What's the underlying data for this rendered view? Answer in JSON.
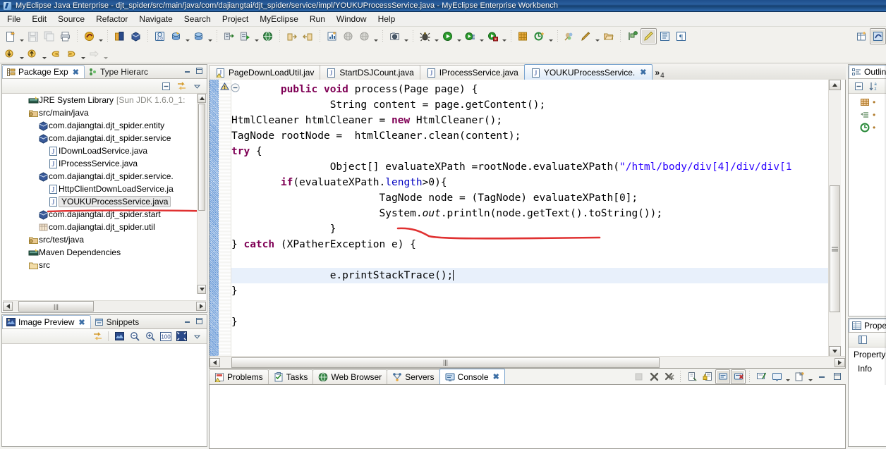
{
  "window": {
    "title": "MyEclipse Java Enterprise - djt_spider/src/main/java/com/dajiangtai/djt_spider/service/impl/YOUKUProcessService.java - MyEclipse Enterprise Workbench",
    "icon": "myeclipse-icon"
  },
  "menubar": {
    "items": [
      {
        "label": "File"
      },
      {
        "label": "Edit"
      },
      {
        "label": "Source"
      },
      {
        "label": "Refactor"
      },
      {
        "label": "Navigate"
      },
      {
        "label": "Search"
      },
      {
        "label": "Project"
      },
      {
        "label": "MyEclipse"
      },
      {
        "label": "Run"
      },
      {
        "label": "Window"
      },
      {
        "label": "Help"
      }
    ]
  },
  "toolbar": {
    "row1": [
      {
        "name": "new-wizard",
        "icon": "new-file-icon",
        "caret": true
      },
      {
        "name": "save",
        "icon": "save-icon",
        "caret": false,
        "disabled": true
      },
      {
        "name": "save-all",
        "icon": "save-all-icon",
        "caret": false,
        "disabled": true
      },
      {
        "name": "print",
        "icon": "print-icon",
        "caret": false
      },
      {
        "sep": true
      },
      {
        "name": "myeclipse-perspective",
        "icon": "myeclipse-icon",
        "caret": true
      },
      {
        "sep": true
      },
      {
        "name": "open-deploy",
        "icon": "deploy-icon",
        "caret": false
      },
      {
        "name": "open-package",
        "icon": "package-icon",
        "caret": false
      },
      {
        "sep": true
      },
      {
        "name": "web-2",
        "icon": "web20-icon",
        "caret": false
      },
      {
        "name": "db-browser",
        "icon": "db-icon",
        "caret": true
      },
      {
        "name": "db-explorer",
        "icon": "db2-icon",
        "caret": true
      },
      {
        "sep": true
      },
      {
        "name": "server-deploy",
        "icon": "server-deploy-icon",
        "caret": false
      },
      {
        "name": "run-server",
        "icon": "run-server-icon",
        "caret": true
      },
      {
        "name": "open-browser",
        "icon": "globe-icon",
        "caret": false
      },
      {
        "sep": true
      },
      {
        "name": "export",
        "icon": "export-icon",
        "caret": false
      },
      {
        "name": "import",
        "icon": "import-icon",
        "caret": false
      },
      {
        "sep": true
      },
      {
        "name": "report",
        "icon": "report-icon",
        "caret": false
      },
      {
        "name": "globe-dim",
        "icon": "globe-dim-icon",
        "caret": false
      },
      {
        "name": "globe-dim-2",
        "icon": "globe-dim2-icon",
        "caret": true
      },
      {
        "sep": true
      },
      {
        "name": "snapshot",
        "icon": "camera-icon",
        "caret": true
      },
      {
        "sep": true
      },
      {
        "name": "debug",
        "icon": "debug-bug-icon",
        "caret": true
      },
      {
        "name": "run",
        "icon": "run-green-icon",
        "caret": true
      },
      {
        "name": "run-history",
        "icon": "run-history-icon",
        "caret": true
      },
      {
        "name": "run-error",
        "icon": "run-error-icon",
        "caret": true
      },
      {
        "sep": true
      },
      {
        "name": "new-java-project",
        "icon": "new-java-project-icon",
        "caret": false
      },
      {
        "name": "new-class",
        "icon": "new-class-icon",
        "caret": true
      },
      {
        "sep": true
      },
      {
        "name": "search-ref",
        "icon": "search-ref-icon",
        "caret": false
      },
      {
        "name": "edit-pencil",
        "icon": "pencil-icon",
        "caret": true
      },
      {
        "name": "open-type",
        "icon": "open-type-icon",
        "caret": false
      },
      {
        "sep": true
      },
      {
        "name": "next-annotation",
        "icon": "next-annotation-icon",
        "caret": false
      },
      {
        "name": "toggle-mark-occurrences",
        "icon": "highlighter-icon",
        "caret": false,
        "pressed": true
      },
      {
        "name": "show-whitespace",
        "icon": "whitespace-icon",
        "caret": false
      },
      {
        "name": "pilcrow",
        "icon": "pilcrow-icon",
        "caret": false
      }
    ],
    "row1_far": [
      {
        "name": "new-table",
        "icon": "new-table-icon"
      },
      {
        "name": "myeclipse-perspective-btn",
        "icon": "perspective-icon",
        "pressed": true
      }
    ],
    "row2": [
      {
        "name": "step-down",
        "icon": "arrow-down-icon",
        "caret": true
      },
      {
        "name": "step-up",
        "icon": "arrow-up-icon",
        "caret": true
      },
      {
        "name": "back",
        "icon": "back-arrow-icon",
        "caret": false
      },
      {
        "name": "forward",
        "icon": "forward-arrow-icon",
        "caret": true
      },
      {
        "name": "next-edit",
        "icon": "next-edit-icon",
        "caret": true,
        "disabled": true
      }
    ]
  },
  "package_explorer": {
    "tabs": [
      {
        "label": "Package Exp",
        "icon": "package-explorer-icon",
        "active": true,
        "closable": true
      },
      {
        "label": "Type Hierarc",
        "icon": "type-hierarchy-icon",
        "active": false,
        "closable": false
      }
    ],
    "toolbar": [
      {
        "name": "collapse-all",
        "icon": "collapse-all-icon"
      },
      {
        "name": "link-with-editor",
        "icon": "link-editor-icon"
      },
      {
        "name": "view-menu",
        "icon": "view-menu-icon"
      }
    ],
    "tree": [
      {
        "label": "JRE System Library",
        "suffix": "[Sun JDK 1.6.0_1:",
        "icon": "library-icon",
        "indent": 2
      },
      {
        "label": "src/main/java",
        "suffix": "",
        "icon": "source-folder-icon",
        "indent": 2
      },
      {
        "label": "com.dajiangtai.djt_spider.entity",
        "suffix": "",
        "icon": "package-icon",
        "indent": 3
      },
      {
        "label": "com.dajiangtai.djt_spider.service",
        "suffix": "",
        "icon": "package-icon",
        "indent": 3
      },
      {
        "label": "IDownLoadService.java",
        "suffix": "",
        "icon": "java-file-icon",
        "indent": 4
      },
      {
        "label": "IProcessService.java",
        "suffix": "",
        "icon": "java-file-icon",
        "indent": 4
      },
      {
        "label": "com.dajiangtai.djt_spider.service.",
        "suffix": "",
        "icon": "package-icon",
        "indent": 3
      },
      {
        "label": "HttpClientDownLoadService.ja",
        "suffix": "",
        "icon": "java-file-icon",
        "indent": 4
      },
      {
        "label": "YOUKUProcessService.java",
        "suffix": "",
        "icon": "java-file-icon",
        "indent": 4,
        "selected": true
      },
      {
        "label": "com.dajiangtai.djt_spider.start",
        "suffix": "",
        "icon": "package-icon",
        "indent": 3
      },
      {
        "label": "com.dajiangtai.djt_spider.util",
        "suffix": "",
        "icon": "package-empty-icon",
        "indent": 3
      },
      {
        "label": "src/test/java",
        "suffix": "",
        "icon": "source-folder-icon",
        "indent": 2
      },
      {
        "label": "Maven Dependencies",
        "suffix": "",
        "icon": "library-icon",
        "indent": 2
      },
      {
        "label": "src",
        "suffix": "",
        "icon": "folder-icon",
        "indent": 2
      }
    ]
  },
  "image_preview": {
    "tabs": [
      {
        "label": "Image Preview",
        "icon": "image-preview-icon",
        "active": true,
        "closable": true
      },
      {
        "label": "Snippets",
        "icon": "snippets-icon",
        "active": false,
        "closable": false
      }
    ],
    "toolbar": [
      {
        "name": "link-with-editor",
        "icon": "link-editor-icon"
      },
      {
        "name": "preview-image",
        "icon": "image-icon"
      },
      {
        "name": "zoom-out",
        "icon": "zoom-out-icon"
      },
      {
        "name": "zoom-in",
        "icon": "zoom-in-icon"
      },
      {
        "name": "zoom-100",
        "icon": "zoom-100-icon",
        "label": "100"
      },
      {
        "name": "fit-to-window",
        "icon": "fit-window-icon"
      },
      {
        "name": "view-menu",
        "icon": "view-menu-icon"
      }
    ]
  },
  "editor": {
    "tabs": [
      {
        "label": "PageDownLoadUtil.jav",
        "icon": "java-file-warning-icon",
        "active": false
      },
      {
        "label": "StartDSJCount.java",
        "icon": "java-file-icon",
        "active": false
      },
      {
        "label": "IProcessService.java",
        "icon": "java-file-icon",
        "active": false
      },
      {
        "label": "YOUKUProcessService.",
        "icon": "java-file-icon",
        "active": true,
        "closable": true
      }
    ],
    "overflow": {
      "symbol": "»",
      "count": "4"
    },
    "code_lines": [
      {
        "indent": 0,
        "tokens": [
          {
            "t": "public",
            "c": "kw"
          },
          {
            "t": " "
          },
          {
            "t": "void",
            "c": "kw"
          },
          {
            "t": " process(Page page) {"
          }
        ]
      },
      {
        "indent": 1,
        "tokens": [
          {
            "t": "String content = page.getContent();"
          }
        ]
      },
      {
        "indent": -1,
        "tokens": [
          {
            "t": "HtmlCleaner htmlCleaner = "
          },
          {
            "t": "new",
            "c": "kw"
          },
          {
            "t": " HtmlCleaner();"
          }
        ]
      },
      {
        "indent": -1,
        "tokens": [
          {
            "t": "TagNode rootNode =  htmlCleaner.clean(content);"
          }
        ]
      },
      {
        "indent": -1,
        "tokens": [
          {
            "t": "try",
            "c": "kw"
          },
          {
            "t": " {"
          }
        ]
      },
      {
        "indent": 1,
        "tokens": [
          {
            "t": "Object[] evaluateXPath =rootNode.evaluateXPath("
          },
          {
            "t": "\"/html/body/div[4]/div/div[1",
            "c": "str"
          }
        ]
      },
      {
        "indent": 0,
        "tokens": [
          {
            "t": "if",
            "c": "kw"
          },
          {
            "t": "(evaluateXPath."
          },
          {
            "t": "length",
            "c": "fld"
          },
          {
            "t": ">0){"
          }
        ]
      },
      {
        "indent": 2,
        "tokens": [
          {
            "t": "TagNode node = (TagNode) evaluateXPath[0];"
          }
        ]
      },
      {
        "indent": 2,
        "tokens": [
          {
            "t": "System."
          },
          {
            "t": "out",
            "c": "stat"
          },
          {
            "t": ".println(node.getText().toString());"
          }
        ]
      },
      {
        "indent": 1,
        "tokens": [
          {
            "t": "}"
          }
        ]
      },
      {
        "indent": -1,
        "tokens": [
          {
            "t": "} "
          },
          {
            "t": "catch",
            "c": "kw"
          },
          {
            "t": " (XPatherException e) {"
          }
        ]
      },
      {
        "indent": 0,
        "tokens": [
          {
            "t": ""
          }
        ]
      },
      {
        "indent": 1,
        "tokens": [
          {
            "t": "e.printStackTrace();"
          }
        ],
        "current": true,
        "caret": true
      },
      {
        "indent": -1,
        "tokens": [
          {
            "t": "}"
          }
        ]
      },
      {
        "indent": 0,
        "tokens": [
          {
            "t": ""
          }
        ]
      },
      {
        "indent": -1,
        "tokens": [
          {
            "t": "}"
          }
        ]
      }
    ]
  },
  "outline": {
    "tab_label": "Outline",
    "icon": "outline-icon",
    "toolbar": [
      {
        "name": "collapse-all",
        "icon": "collapse-all-icon"
      },
      {
        "name": "sort",
        "icon": "sort-az-icon"
      }
    ],
    "items": [
      {
        "icon": "package-icon"
      },
      {
        "icon": "import-declaration-icon"
      },
      {
        "icon": "class-icon"
      }
    ]
  },
  "properties": {
    "tab_label": "Prope",
    "icon": "properties-icon",
    "columns": [
      "Property",
      "Info"
    ]
  },
  "bottom_panel": {
    "tabs": [
      {
        "label": "Problems",
        "icon": "problems-icon",
        "active": false
      },
      {
        "label": "Tasks",
        "icon": "tasks-icon",
        "active": false
      },
      {
        "label": "Web Browser",
        "icon": "web-browser-icon",
        "active": false
      },
      {
        "label": "Servers",
        "icon": "servers-icon",
        "active": false
      },
      {
        "label": "Console",
        "icon": "console-icon",
        "active": true,
        "closable": true
      }
    ],
    "toolbar": [
      {
        "name": "terminate",
        "icon": "terminate-icon",
        "disabled": true
      },
      {
        "name": "remove-launch",
        "icon": "remove-icon"
      },
      {
        "name": "remove-all-terminated",
        "icon": "remove-all-icon"
      },
      {
        "sep": true
      },
      {
        "name": "clear-console",
        "icon": "clear-console-icon"
      },
      {
        "name": "scroll-lock",
        "icon": "scroll-lock-icon"
      },
      {
        "name": "show-console-on-output",
        "icon": "show-console-icon",
        "pressed": true
      },
      {
        "name": "show-console-on-error",
        "icon": "show-console-error-icon",
        "pressed": true
      },
      {
        "sep": true
      },
      {
        "name": "pin-console",
        "icon": "pin-console-icon"
      },
      {
        "name": "display-selected-console",
        "icon": "display-console-icon",
        "caret": true
      },
      {
        "name": "open-console",
        "icon": "open-console-icon",
        "caret": true
      },
      {
        "name": "minimize",
        "icon": "minimize-icon"
      },
      {
        "name": "maximize",
        "icon": "maximize-icon"
      }
    ]
  },
  "colors": {
    "title_bar": "#2a5f9e",
    "keyword": "#7f0055",
    "string": "#2a00ff",
    "field": "#0000c0",
    "current_line": "#e8f0fb",
    "annotation_red": "#e03131",
    "tab_active_border": "#7aa4cf"
  }
}
